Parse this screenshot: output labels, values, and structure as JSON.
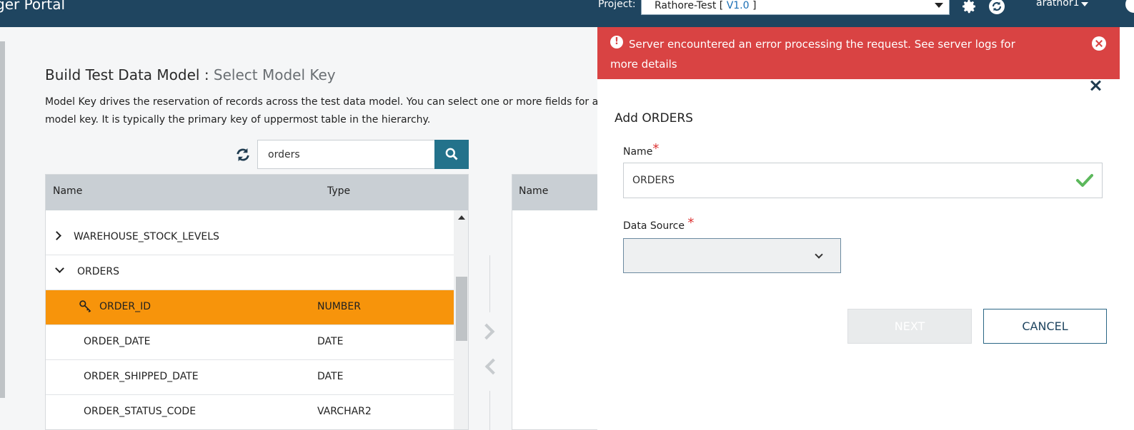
{
  "topbar": {
    "brand": "ger Portal",
    "project_label": "Project:",
    "project_name": "Rathore-Test [ ",
    "project_version": "V1.0",
    "project_close": " ]",
    "user": "arathor1"
  },
  "page": {
    "title": "Build Test Data Model",
    "title_sep": " : ",
    "subtitle": "Select Model Key",
    "description": "Model Key drives the reservation of records across the test data model. You can select one or more fields for a model key. It is typically the primary key of uppermost table in the hierarchy."
  },
  "search": {
    "value": "orders"
  },
  "table": {
    "col_name": "Name",
    "col_type": "Type",
    "rows": [
      {
        "name": "WAREHOUSE_STOCK_LEVELS",
        "type": ""
      },
      {
        "name": "ORDERS",
        "type": ""
      },
      {
        "name": "ORDER_ID",
        "type": "NUMBER"
      },
      {
        "name": "ORDER_DATE",
        "type": "DATE"
      },
      {
        "name": "ORDER_SHIPPED_DATE",
        "type": "DATE"
      },
      {
        "name": "ORDER_STATUS_CODE",
        "type": "VARCHAR2"
      }
    ]
  },
  "right_table": {
    "col_name": "Name"
  },
  "error": {
    "message": "Server encountered an error processing the request. See server logs for more details"
  },
  "panel": {
    "title": "Add ORDERS",
    "name_label": "Name",
    "name_value": "ORDERS",
    "datasource_label": "Data Source",
    "required_mark": "*",
    "next_label": "NEXT",
    "cancel_label": "CANCEL"
  },
  "colors": {
    "topbar": "#1f4560",
    "selected_row": "#f7940b",
    "error": "#d94343",
    "accent": "#23728b"
  }
}
